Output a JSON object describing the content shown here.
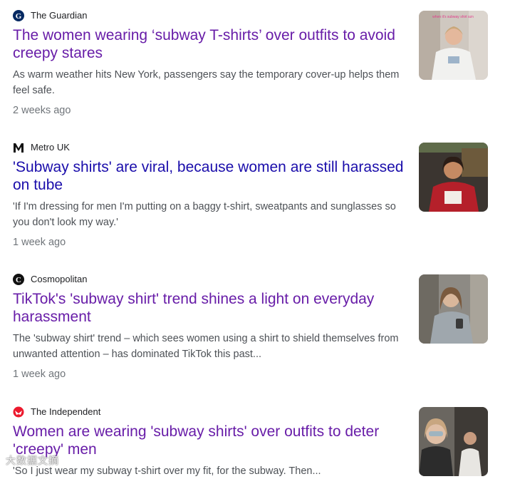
{
  "articles": [
    {
      "source": "The Guardian",
      "title": "The women wearing ‘subway T-shirts’ over outfits to avoid creepy stares",
      "snippet": "As warm weather hits New York, passengers say the temporary cover-up helps them feel safe.",
      "age": "2 weeks ago",
      "thumb_caption": "when it's subway shirt szn"
    },
    {
      "source": "Metro UK",
      "title": "'Subway shirts' are viral, because women are still harassed on tube",
      "snippet": "'If I'm dressing for men I'm putting on a baggy t-shirt, sweatpants and sunglasses so you don't look my way.'",
      "age": "1 week ago"
    },
    {
      "source": "Cosmopolitan",
      "title": "TikTok's 'subway shirt' trend shines a light on everyday harassment",
      "snippet": "The 'subway shirt' trend – which sees women using a shirt to shield themselves from unwanted attention – has dominated TikTok this past...",
      "age": "1 week ago"
    },
    {
      "source": "The Independent",
      "title": "Women are wearing 'subway shirts' over outfits to deter 'creepy' men",
      "snippet": "'So I just wear my subway t-shirt over my fit, for the subway. Then...",
      "age": ""
    }
  ],
  "watermark": "大数据文摘",
  "colors": {
    "title": "#681da8",
    "snippet": "#4d5156",
    "age": "#70757a",
    "source": "#202124"
  }
}
